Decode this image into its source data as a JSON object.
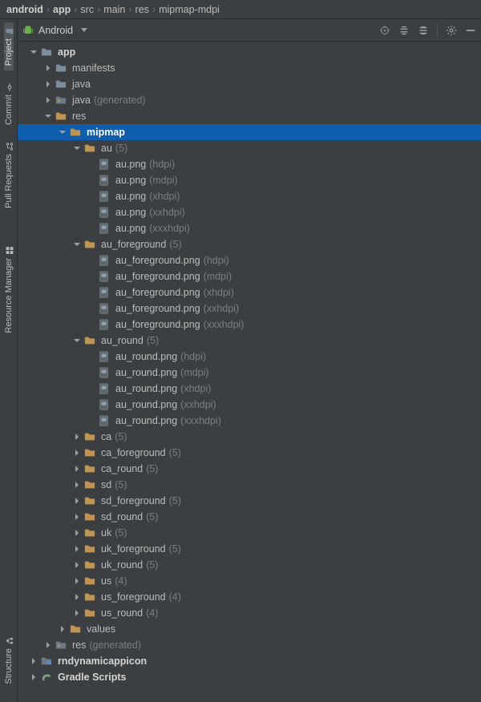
{
  "breadcrumbs": [
    "android",
    "app",
    "src",
    "main",
    "res",
    "mipmap-mdpi"
  ],
  "gutter": {
    "project": "Project",
    "commit": "Commit",
    "pull": "Pull Requests",
    "resourceManager": "Resource Manager",
    "structure": "Structure"
  },
  "panel": {
    "viewName": "Android"
  },
  "tree": [
    {
      "d": 0,
      "arrow": "open",
      "icon": "folder",
      "bold": true,
      "label": "app"
    },
    {
      "d": 1,
      "arrow": "closed",
      "icon": "folder",
      "label": "manifests"
    },
    {
      "d": 1,
      "arrow": "closed",
      "icon": "folder",
      "label": "java"
    },
    {
      "d": 1,
      "arrow": "closed",
      "icon": "folder-gen",
      "label": "java",
      "suffix": "(generated)"
    },
    {
      "d": 1,
      "arrow": "open",
      "icon": "folder-res",
      "label": "res"
    },
    {
      "d": 2,
      "arrow": "open",
      "icon": "folder-res",
      "bold": true,
      "label": "mipmap",
      "selected": true
    },
    {
      "d": 3,
      "arrow": "open",
      "icon": "folder-res",
      "label": "au",
      "suffix": "(5)"
    },
    {
      "d": 4,
      "arrow": "none",
      "icon": "file-img",
      "label": "au.png",
      "suffix": "(hdpi)"
    },
    {
      "d": 4,
      "arrow": "none",
      "icon": "file-img",
      "label": "au.png",
      "suffix": "(mdpi)"
    },
    {
      "d": 4,
      "arrow": "none",
      "icon": "file-img",
      "label": "au.png",
      "suffix": "(xhdpi)"
    },
    {
      "d": 4,
      "arrow": "none",
      "icon": "file-img",
      "label": "au.png",
      "suffix": "(xxhdpi)"
    },
    {
      "d": 4,
      "arrow": "none",
      "icon": "file-img",
      "label": "au.png",
      "suffix": "(xxxhdpi)"
    },
    {
      "d": 3,
      "arrow": "open",
      "icon": "folder-res",
      "label": "au_foreground",
      "suffix": "(5)"
    },
    {
      "d": 4,
      "arrow": "none",
      "icon": "file-img",
      "label": "au_foreground.png",
      "suffix": "(hdpi)"
    },
    {
      "d": 4,
      "arrow": "none",
      "icon": "file-img",
      "label": "au_foreground.png",
      "suffix": "(mdpi)"
    },
    {
      "d": 4,
      "arrow": "none",
      "icon": "file-img",
      "label": "au_foreground.png",
      "suffix": "(xhdpi)"
    },
    {
      "d": 4,
      "arrow": "none",
      "icon": "file-img",
      "label": "au_foreground.png",
      "suffix": "(xxhdpi)"
    },
    {
      "d": 4,
      "arrow": "none",
      "icon": "file-img",
      "label": "au_foreground.png",
      "suffix": "(xxxhdpi)"
    },
    {
      "d": 3,
      "arrow": "open",
      "icon": "folder-res",
      "label": "au_round",
      "suffix": "(5)"
    },
    {
      "d": 4,
      "arrow": "none",
      "icon": "file-img",
      "label": "au_round.png",
      "suffix": "(hdpi)"
    },
    {
      "d": 4,
      "arrow": "none",
      "icon": "file-img",
      "label": "au_round.png",
      "suffix": "(mdpi)"
    },
    {
      "d": 4,
      "arrow": "none",
      "icon": "file-img",
      "label": "au_round.png",
      "suffix": "(xhdpi)"
    },
    {
      "d": 4,
      "arrow": "none",
      "icon": "file-img",
      "label": "au_round.png",
      "suffix": "(xxhdpi)"
    },
    {
      "d": 4,
      "arrow": "none",
      "icon": "file-img",
      "label": "au_round.png",
      "suffix": "(xxxhdpi)"
    },
    {
      "d": 3,
      "arrow": "closed",
      "icon": "folder-res",
      "label": "ca",
      "suffix": "(5)"
    },
    {
      "d": 3,
      "arrow": "closed",
      "icon": "folder-res",
      "label": "ca_foreground",
      "suffix": "(5)"
    },
    {
      "d": 3,
      "arrow": "closed",
      "icon": "folder-res",
      "label": "ca_round",
      "suffix": "(5)"
    },
    {
      "d": 3,
      "arrow": "closed",
      "icon": "folder-res",
      "label": "sd",
      "suffix": "(5)"
    },
    {
      "d": 3,
      "arrow": "closed",
      "icon": "folder-res",
      "label": "sd_foreground",
      "suffix": "(5)"
    },
    {
      "d": 3,
      "arrow": "closed",
      "icon": "folder-res",
      "label": "sd_round",
      "suffix": "(5)"
    },
    {
      "d": 3,
      "arrow": "closed",
      "icon": "folder-res",
      "label": "uk",
      "suffix": "(5)"
    },
    {
      "d": 3,
      "arrow": "closed",
      "icon": "folder-res",
      "label": "uk_foreground",
      "suffix": "(5)"
    },
    {
      "d": 3,
      "arrow": "closed",
      "icon": "folder-res",
      "label": "uk_round",
      "suffix": "(5)"
    },
    {
      "d": 3,
      "arrow": "closed",
      "icon": "folder-res",
      "label": "us",
      "suffix": "(4)"
    },
    {
      "d": 3,
      "arrow": "closed",
      "icon": "folder-res",
      "label": "us_foreground",
      "suffix": "(4)"
    },
    {
      "d": 3,
      "arrow": "closed",
      "icon": "folder-res",
      "label": "us_round",
      "suffix": "(4)"
    },
    {
      "d": 2,
      "arrow": "closed",
      "icon": "folder-res",
      "label": "values"
    },
    {
      "d": 1,
      "arrow": "closed",
      "icon": "folder-gen",
      "label": "res",
      "suffix": "(generated)"
    },
    {
      "d": 0,
      "arrow": "closed",
      "icon": "folder-mod",
      "bold": true,
      "label": "rndynamicappicon"
    },
    {
      "d": 0,
      "arrow": "closed",
      "icon": "gradle",
      "bold": true,
      "label": "Gradle Scripts"
    }
  ]
}
